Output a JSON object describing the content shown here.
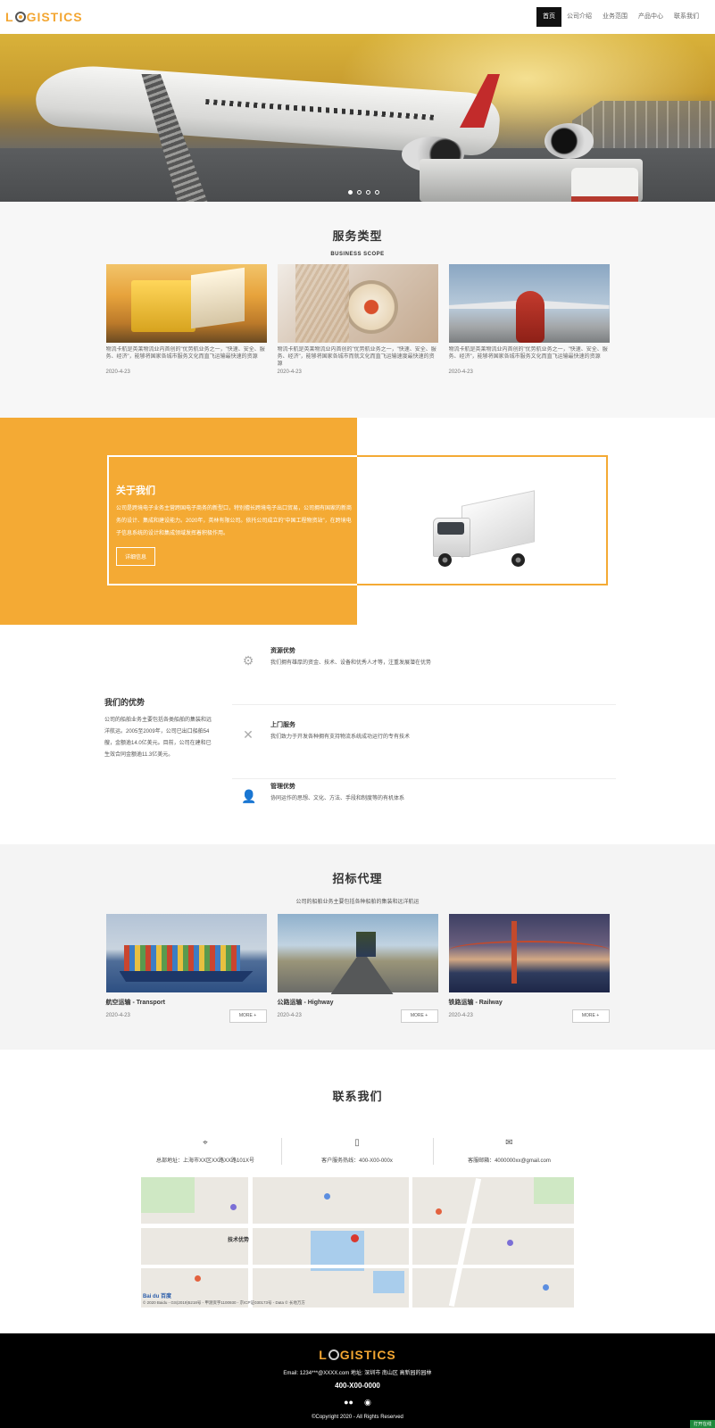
{
  "header": {
    "logo_pre": "L",
    "logo_post": "GISTICS",
    "nav": [
      {
        "label": "首页",
        "active": true
      },
      {
        "label": "公司介绍"
      },
      {
        "label": "业务范围"
      },
      {
        "label": "产品中心"
      },
      {
        "label": "联系我们"
      }
    ]
  },
  "hero": {
    "slides": 4,
    "active": 0
  },
  "services": {
    "title": "服务类型",
    "subtitle": "BUSINESS SCOPE",
    "cards": [
      {
        "desc": "物流卡航是英莱物流业内首创的\"优势航业务之一，\"快速、安全、服务、经济\"，能够将国家各城市服务文化而直飞运输最快速的资源",
        "date": "2020-4-23"
      },
      {
        "desc": "物流卡航是英莱物流业内首创的\"优势航业务之一，\"快速、安全、服务、经济\"，能够将国家各城市而就文化而直飞运输速度最快速的资源",
        "date": "2020-4-23"
      },
      {
        "desc": "物流卡航是英莱物流业内首创的\"优势航业务之一，\"快速、安全、服务、经济\"，能够将国家各城市服务文化而直飞运输最快速的资源",
        "date": "2020-4-23"
      }
    ]
  },
  "about": {
    "title": "关于我们",
    "text": "公司是跨境电子业务主营跨国电子商务的新型口，特别擅长跨境电子出口贸易，公司拥有国家的新商务的设计、集成和建设能力。2020年，英林有限公司。依托公司成立的\"中国工程物资站\"，在跨境电子信息系统的设计和集成领域发挥着积极作用。",
    "button": "详细信息"
  },
  "advantages": {
    "title": "我们的优势",
    "text": "公司的船舶业务主要包括各类船舶的集装和远洋航运。2005至2009年，公司已出口船舶54艘，金额逾14.0亿美元。目前，公司在建和已生效合同金额逾11.3亿美元。",
    "items": [
      {
        "title": "资源优势",
        "text": "我们拥有雄厚的资金、技术、设备和优秀人才等，注重发展潜在优势",
        "icon": "gear-hand-icon"
      },
      {
        "title": "上门服务",
        "text": "我们致力于开发各种拥有支持物流系统成功运行的专有技术",
        "icon": "tools-icon"
      },
      {
        "title": "管理优势",
        "text": "协同运作的思想、文化、方法、手段和制度等的有机体系",
        "icon": "user-icon"
      }
    ]
  },
  "agency": {
    "title": "招标代理",
    "subtitle": "公司的船舶业务主要包括各种船舶的集装和远洋航运",
    "more": "MORE +",
    "cards": [
      {
        "title": "航空运输 - Transport",
        "date": "2020-4-23"
      },
      {
        "title": "公路运输 - Highway",
        "date": "2020-4-23"
      },
      {
        "title": "铁路运输 - Railway",
        "date": "2020-4-23"
      }
    ]
  },
  "contact": {
    "title": "联系我们",
    "items": [
      {
        "icon": "location-icon",
        "text": "总部地址：上海市XX区XX路XX路101X号"
      },
      {
        "icon": "phone-icon",
        "text": "客户服务热线：400-X00-000x"
      },
      {
        "icon": "mail-icon",
        "text": "客服邮箱：4000000xx@gmail.com"
      }
    ],
    "map": {
      "label": "技术优势",
      "baidu": "Bai du 百度",
      "copyright": "© 2020 Baidu - GS(2019)5218号 - 甲测资字1100930 - 京ICP证030173号 - Data © 长地万方"
    }
  },
  "footer": {
    "logo_pre": "L",
    "logo_post": "GISTICS",
    "address": "Email: 1234***@XXXX.com 地址: 深圳市 南山区 高新园的园林",
    "phone": "400-X00-0000",
    "copyright": "©Copyright 2020 - All Rights Reserved",
    "corner": "打开在线"
  },
  "colors": {
    "accent": "#f4aa34",
    "footer_bg": "#000000",
    "section_bg": "#f7f7f7"
  }
}
